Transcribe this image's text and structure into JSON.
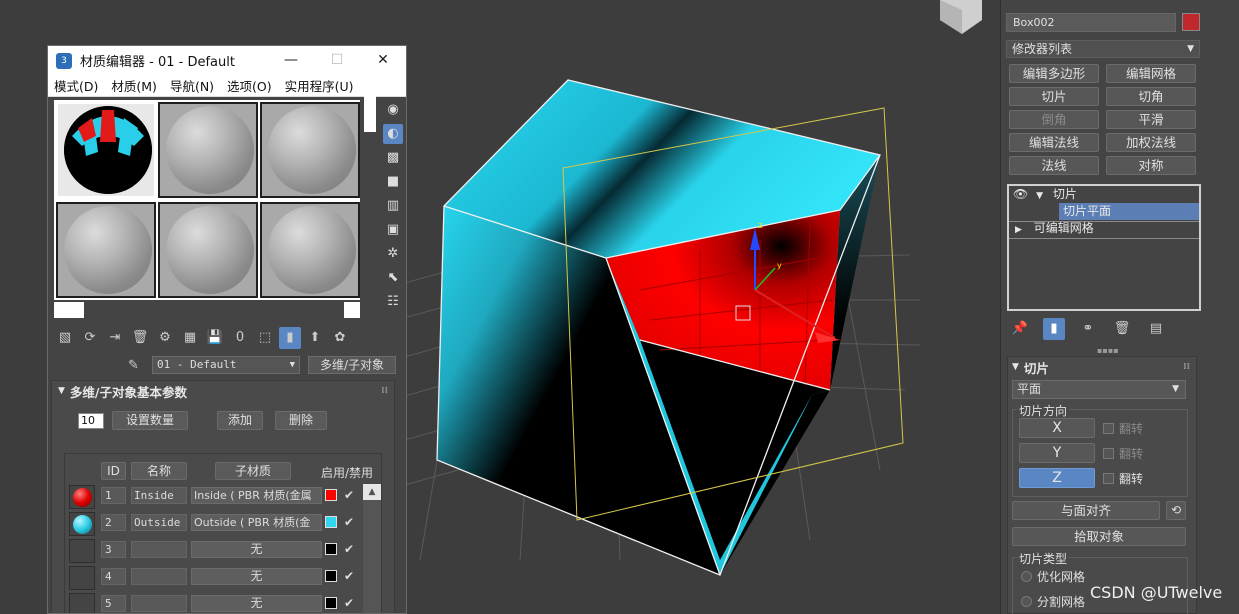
{
  "material_editor": {
    "title": "材质编辑器 - 01 - Default",
    "menu": [
      "模式(D)",
      "材质(M)",
      "导航(N)",
      "选项(O)",
      "实用程序(U)"
    ],
    "material_name": "01 - Default",
    "material_type_button": "多维/子对象",
    "rollout_title": "多维/子对象基本参数",
    "count_value": "10",
    "set_count_label": "设置数量",
    "add_label": "添加",
    "delete_label": "删除",
    "columns": {
      "id": "ID",
      "name": "名称",
      "sub_material": "子材质",
      "enable": "启用/禁用"
    },
    "rows": [
      {
        "id": "1",
        "name": "Inside",
        "sub_material": "Inside  ( PBR 材质(金属",
        "chip_color": "#ff0000",
        "ball": "red",
        "enabled": "✔"
      },
      {
        "id": "2",
        "name": "Outside",
        "sub_material": "Outside  ( PBR 材质(金",
        "chip_color": "#33d6f0",
        "ball": "cyan",
        "enabled": "✔"
      },
      {
        "id": "3",
        "name": "",
        "sub_material": "无",
        "chip_color": "#000000",
        "ball": "",
        "enabled": "✔"
      },
      {
        "id": "4",
        "name": "",
        "sub_material": "无",
        "chip_color": "#000000",
        "ball": "",
        "enabled": "✔"
      },
      {
        "id": "5",
        "name": "",
        "sub_material": "无",
        "chip_color": "#000000",
        "ball": "",
        "enabled": "✔"
      }
    ]
  },
  "command_panel": {
    "object_name": "Box002",
    "object_color": "#c0282e",
    "modifier_list": "修改器列表",
    "buttons": [
      {
        "label": "编辑多边形",
        "dim": false
      },
      {
        "label": "编辑网格",
        "dim": false
      },
      {
        "label": "切片",
        "dim": false
      },
      {
        "label": "切角",
        "dim": false
      },
      {
        "label": "倒角",
        "dim": true
      },
      {
        "label": "平滑",
        "dim": false
      },
      {
        "label": "编辑法线",
        "dim": false
      },
      {
        "label": "加权法线",
        "dim": false
      },
      {
        "label": "法线",
        "dim": false
      },
      {
        "label": "对称",
        "dim": false
      }
    ],
    "stack": {
      "modifier": "切片",
      "sub_object": "切片平面",
      "base": "可编辑网格"
    },
    "slice": {
      "rollout_title": "切片",
      "plane_select": "平面",
      "direction_title": "切片方向",
      "axes": [
        "X",
        "Y",
        "Z"
      ],
      "active_axis": "Z",
      "flip_label": "翻转",
      "align_face": "与面对齐",
      "pick_object": "拾取对象",
      "type_title": "切片类型",
      "types": [
        "优化网格",
        "分割网格"
      ]
    }
  },
  "watermark": "CSDN @UTwelve",
  "colors": {
    "accent": "#5a87c4",
    "cyan": "#33d6f0",
    "red": "#ff0000"
  }
}
